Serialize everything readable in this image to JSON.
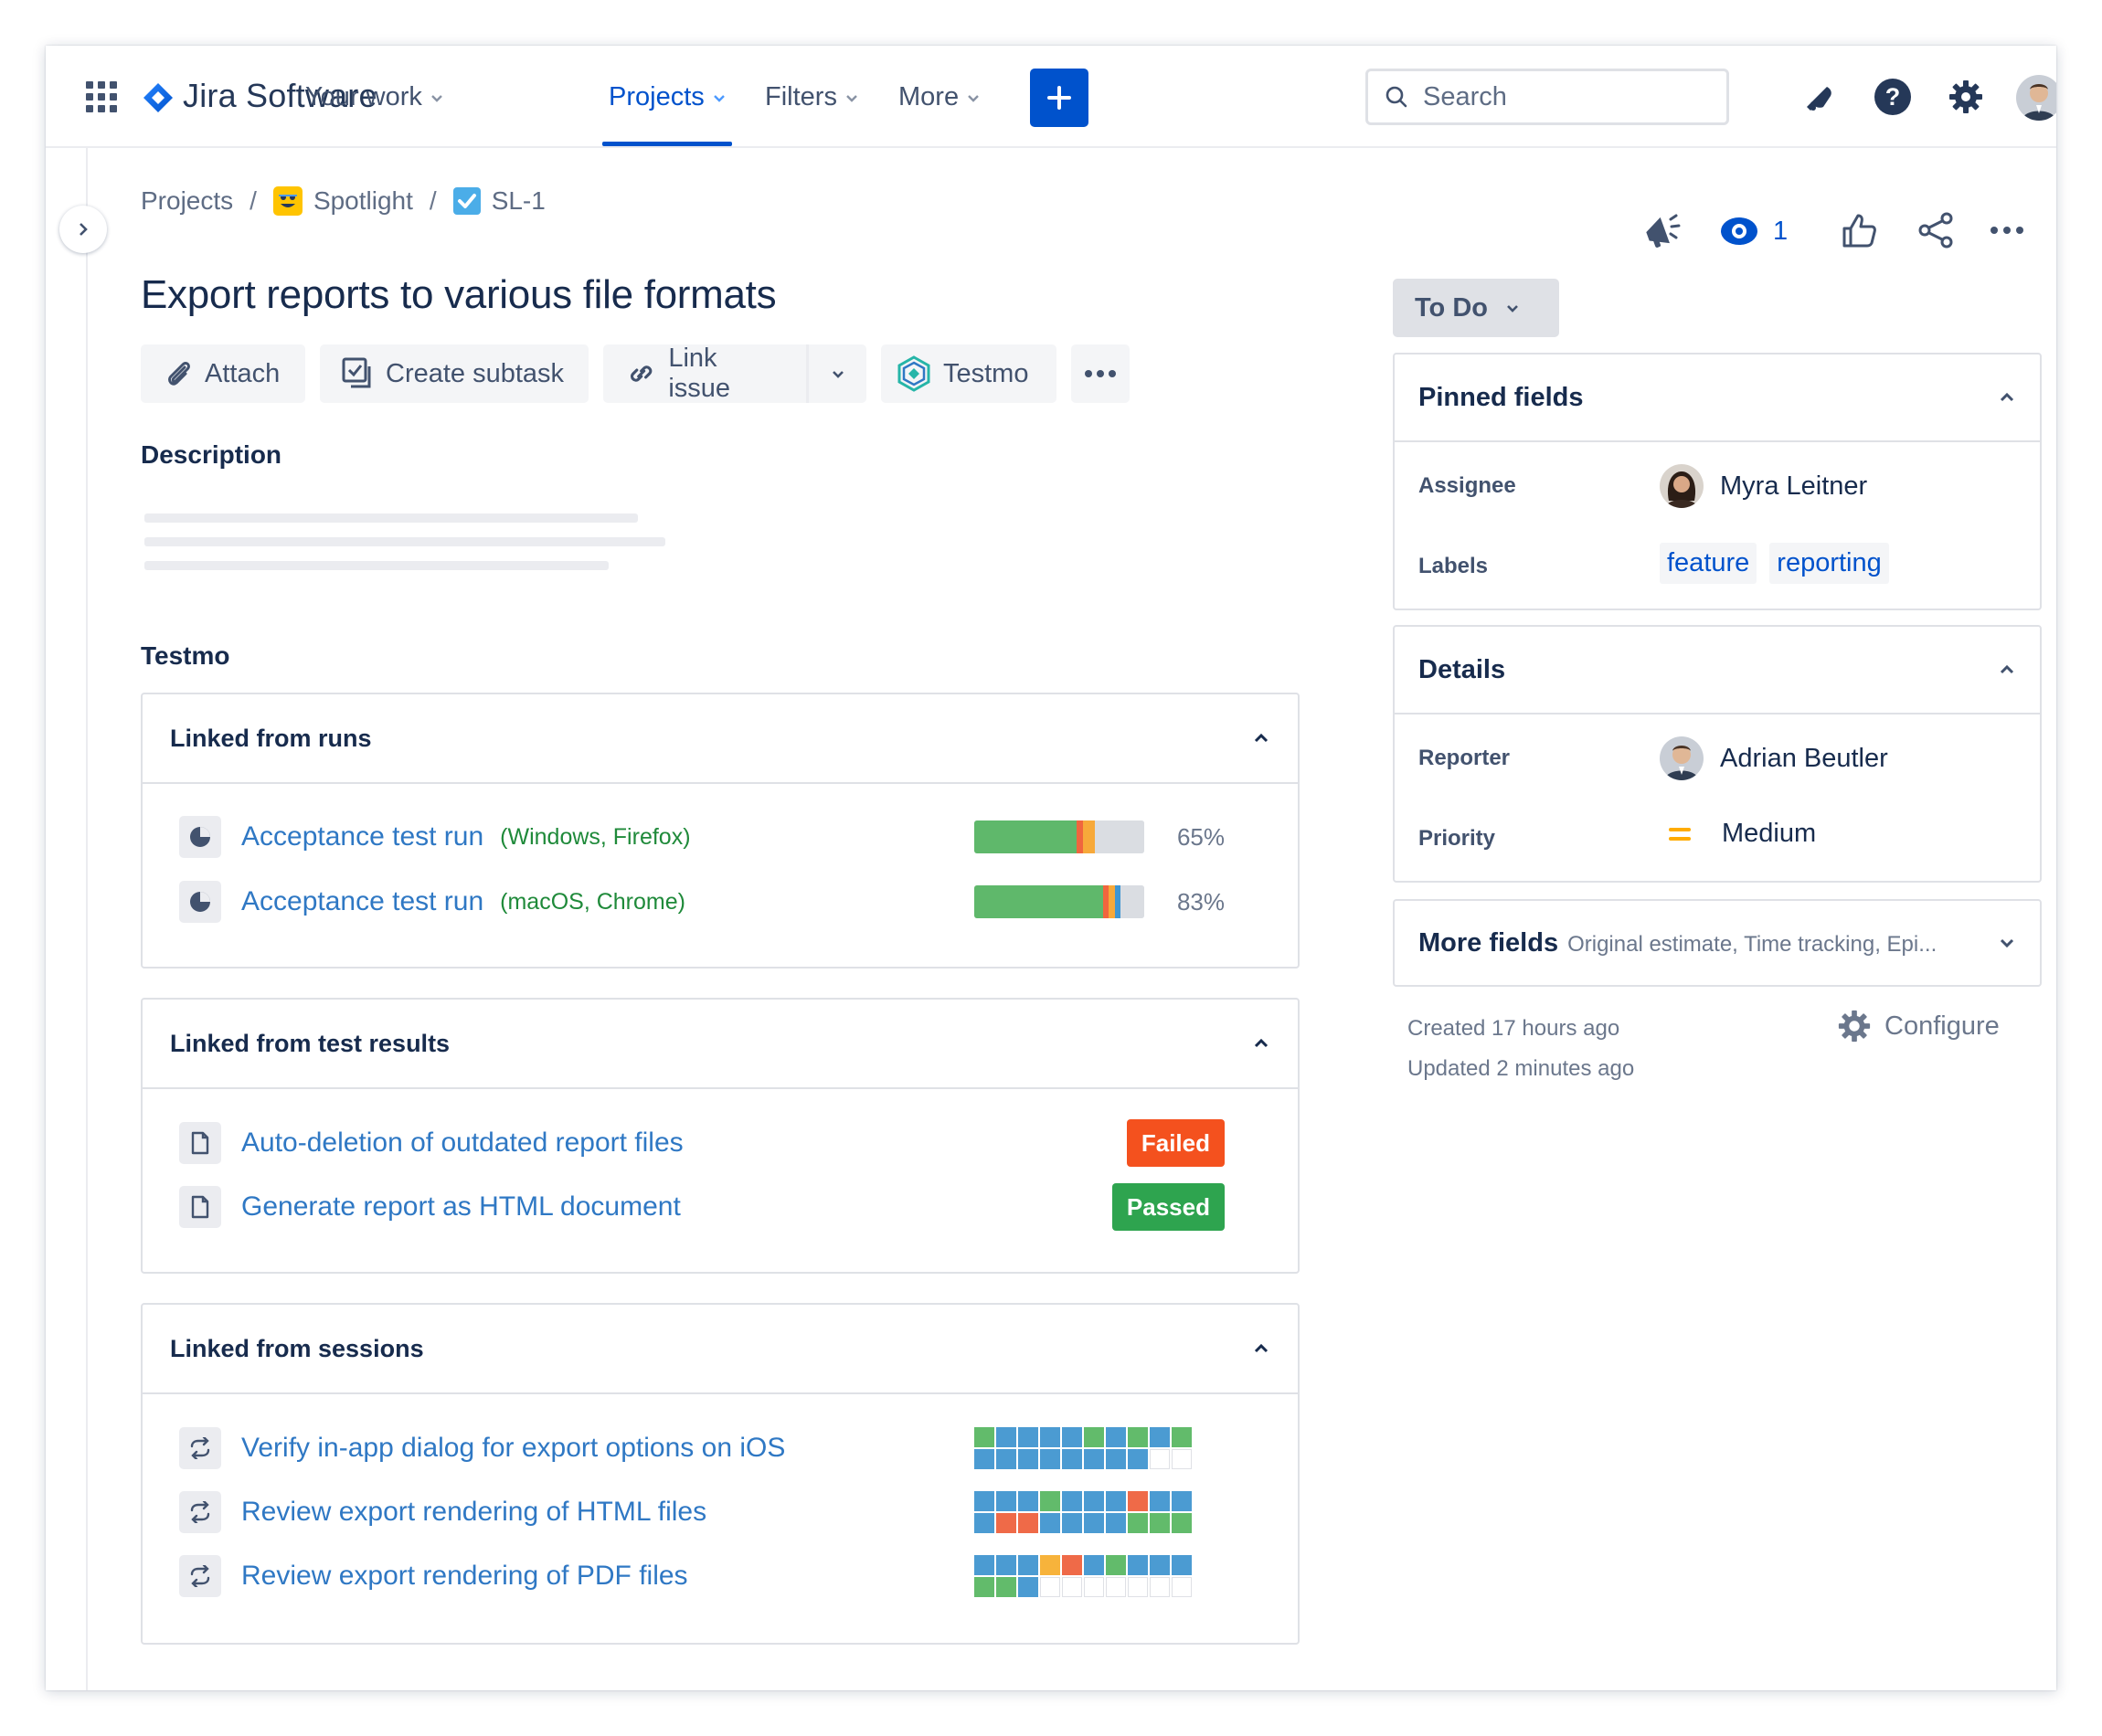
{
  "nav": {
    "product": "Jira Software",
    "items": [
      {
        "label": "Your work"
      },
      {
        "label": "Projects"
      },
      {
        "label": "Filters"
      },
      {
        "label": "More"
      }
    ],
    "search_placeholder": "Search"
  },
  "breadcrumb": {
    "root": "Projects",
    "project": "Spotlight",
    "issue_key": "SL-1"
  },
  "issue": {
    "title": "Export reports to various file formats",
    "watchers": "1"
  },
  "toolbar": {
    "attach": "Attach",
    "create_subtask": "Create subtask",
    "link_issue": "Link issue",
    "testmo": "Testmo"
  },
  "description_label": "Description",
  "testmo": {
    "heading": "Testmo",
    "runs": {
      "title": "Linked from runs",
      "items": [
        {
          "name": "Acceptance test run",
          "config": "(Windows, Firefox)",
          "percent": "65%",
          "progress": {
            "passed": 0.6,
            "failed": 0.04,
            "blocked": 0.07,
            "retest": 0.0,
            "untested": 0.29
          }
        },
        {
          "name": "Acceptance test run",
          "config": "(macOS, Chrome)",
          "percent": "83%",
          "progress": {
            "passed": 0.76,
            "failed": 0.03,
            "blocked": 0.04,
            "retest": 0.03,
            "untested": 0.14
          }
        }
      ]
    },
    "results": {
      "title": "Linked from test results",
      "items": [
        {
          "name": "Auto-deletion of outdated report files",
          "status": "Failed",
          "color": "#f4511e"
        },
        {
          "name": "Generate report as HTML document",
          "status": "Passed",
          "color": "#2ea44f"
        }
      ]
    },
    "sessions": {
      "title": "Linked from sessions",
      "items": [
        {
          "name": "Verify in-app dialog for export options on iOS",
          "cells": [
            "g",
            "b",
            "b",
            "b",
            "b",
            "g",
            "b",
            "g",
            "b",
            "g",
            "b",
            "b",
            "b",
            "b",
            "b",
            "b",
            "b",
            "b",
            "e",
            "e"
          ]
        },
        {
          "name": "Review export rendering of HTML files",
          "cells": [
            "b",
            "b",
            "b",
            "g",
            "b",
            "b",
            "b",
            "r",
            "b",
            "b",
            "b",
            "r",
            "r",
            "b",
            "b",
            "b",
            "b",
            "g",
            "g",
            "g"
          ]
        },
        {
          "name": "Review export rendering of PDF files",
          "cells": [
            "b",
            "b",
            "b",
            "y",
            "r",
            "b",
            "g",
            "b",
            "b",
            "b",
            "g",
            "g",
            "b",
            "e",
            "e",
            "e",
            "e",
            "e",
            "e",
            "e"
          ]
        }
      ]
    }
  },
  "sidebar": {
    "status": "To Do",
    "pinned": {
      "title": "Pinned fields",
      "assignee_label": "Assignee",
      "assignee": "Myra Leitner",
      "labels_label": "Labels",
      "labels": [
        "feature",
        "reporting"
      ]
    },
    "details": {
      "title": "Details",
      "reporter_label": "Reporter",
      "reporter": "Adrian Beutler",
      "priority_label": "Priority",
      "priority": "Medium"
    },
    "more_fields": {
      "title": "More fields",
      "summary": "Original estimate, Time tracking, Epi..."
    },
    "created": "Created 17 hours ago",
    "updated": "Updated 2 minutes ago",
    "configure": "Configure"
  },
  "colors": {
    "brand": "#0052cc",
    "link": "#2f78c4",
    "passed": "#5fb86b",
    "failed": "#f0663e",
    "blocked": "#f7a93a",
    "retest": "#3f96d3",
    "untested": "#dadde2",
    "session_blue": "#4b9bd2",
    "session_green": "#62bb6b",
    "session_red": "#ef6a48",
    "session_yellow": "#f7b33b"
  }
}
